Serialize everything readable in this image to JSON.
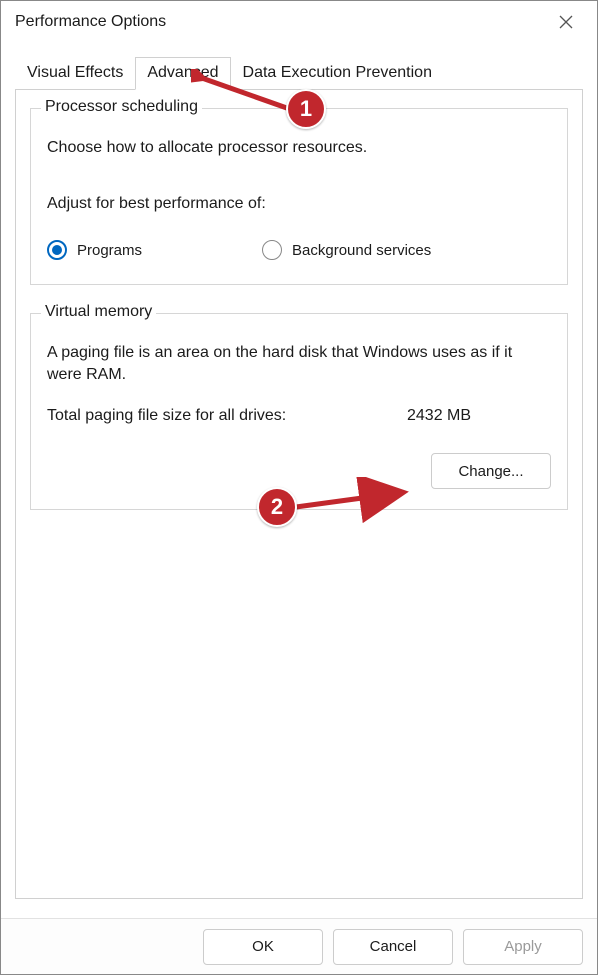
{
  "window": {
    "title": "Performance Options"
  },
  "tabs": {
    "visual_effects": "Visual Effects",
    "advanced": "Advanced",
    "dep": "Data Execution Prevention"
  },
  "processor": {
    "legend": "Processor scheduling",
    "desc": "Choose how to allocate processor resources.",
    "adjust_label": "Adjust for best performance of:",
    "radio_programs": "Programs",
    "radio_background": "Background services"
  },
  "vm": {
    "legend": "Virtual memory",
    "desc": "A paging file is an area on the hard disk that Windows uses as if it were RAM.",
    "total_label": "Total paging file size for all drives:",
    "total_value": "2432 MB",
    "change_button": "Change..."
  },
  "footer": {
    "ok": "OK",
    "cancel": "Cancel",
    "apply": "Apply"
  },
  "annotations": {
    "badge1": "1",
    "badge2": "2"
  }
}
